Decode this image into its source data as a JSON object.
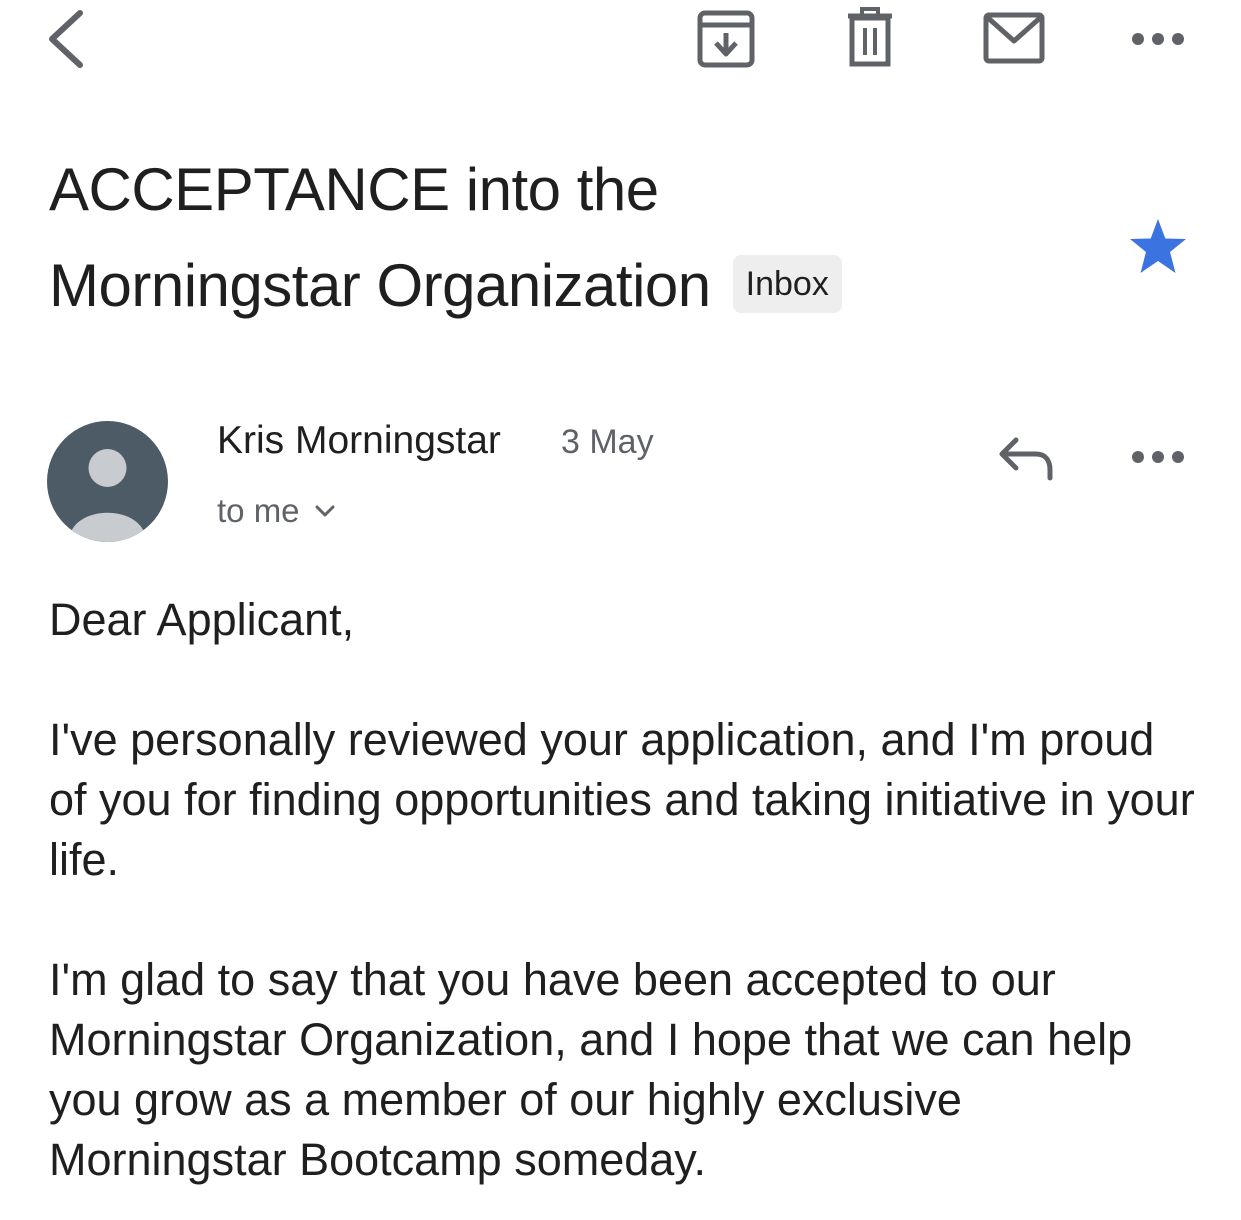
{
  "subject": {
    "line1": "ACCEPTANCE into the",
    "line2": "Morningstar Organization",
    "label": "Inbox"
  },
  "icons": {
    "back": "chevron-left-icon",
    "archive": "archive-icon",
    "delete": "trash-icon",
    "mark_unread": "mail-icon",
    "more": "more-horizontal-icon",
    "star": "star-icon",
    "reply": "reply-icon",
    "avatar": "person-icon",
    "recipient_dropdown": "chevron-down-icon"
  },
  "colors": {
    "star": "#3b73e0",
    "icon": "#5f6368",
    "avatar_bg": "#4d5b67",
    "avatar_person": "#c8ccd0",
    "label_bg": "#eeeeee"
  },
  "message": {
    "sender": "Kris Morningstar",
    "date": "3 May",
    "recipient": "to me",
    "starred": true,
    "paragraphs": [
      "Dear Applicant,",
      "I've personally reviewed your application, and I'm proud of you for finding opportunities and taking initiative in your life.",
      "I'm glad to say that you have been accepted to our Morningstar Organization, and I hope that we can help you grow as a member of our highly exclusive Morningstar Bootcamp someday."
    ]
  }
}
